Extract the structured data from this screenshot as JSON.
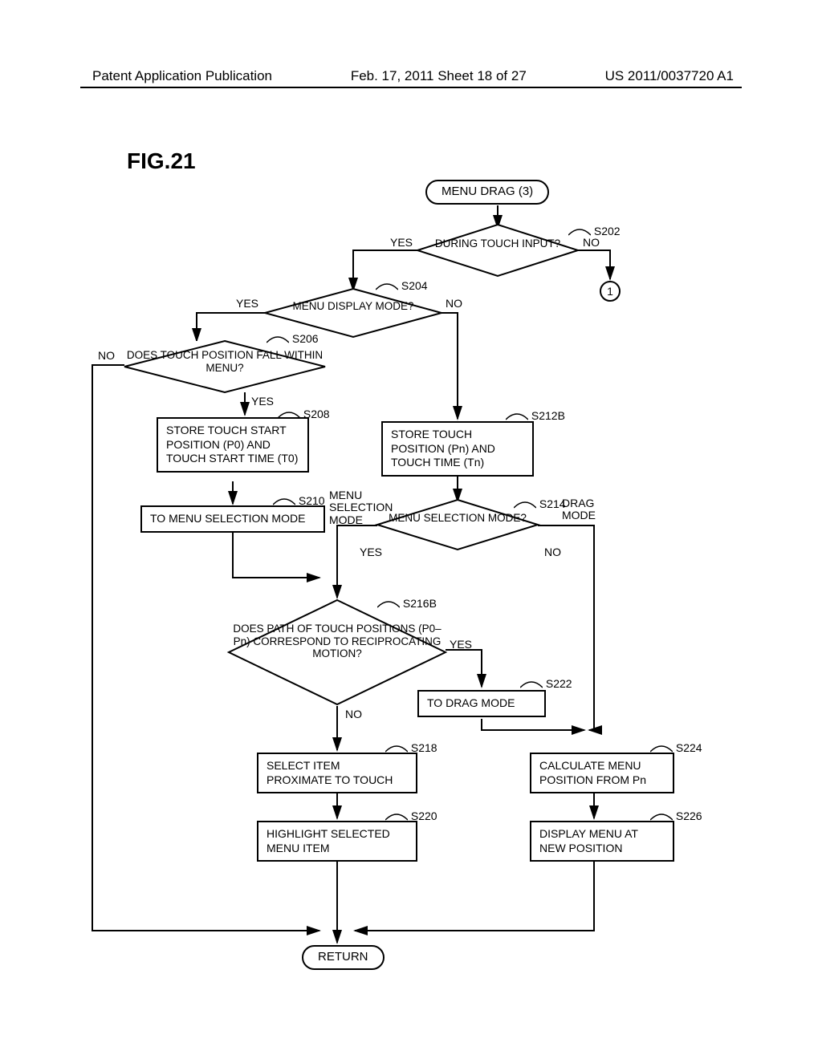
{
  "header": {
    "left": "Patent Application Publication",
    "center": "Feb. 17, 2011  Sheet 18 of 27",
    "right": "US 2011/0037720 A1"
  },
  "figure_label": "FIG.21",
  "chart_data": {
    "type": "flowchart",
    "title": "MENU DRAG (3)",
    "nodes": [
      {
        "id": "start",
        "type": "terminal",
        "text": "MENU DRAG (3)"
      },
      {
        "id": "s202",
        "type": "decision",
        "step": "S202",
        "text": "DURING TOUCH INPUT?",
        "yes_to": "s204",
        "no_to": "conn1"
      },
      {
        "id": "s204",
        "type": "decision",
        "step": "S204",
        "text": "MENU DISPLAY MODE?",
        "yes_to": "s206",
        "no_to": "s212b"
      },
      {
        "id": "s206",
        "type": "decision",
        "step": "S206",
        "text": "DOES TOUCH POSITION FALL WITHIN MENU?",
        "yes_to": "s208",
        "no_to": "return"
      },
      {
        "id": "s208",
        "type": "process",
        "step": "S208",
        "text": "STORE TOUCH START POSITION (P0) AND TOUCH START TIME (T0)",
        "to": "s210"
      },
      {
        "id": "s210",
        "type": "process",
        "step": "S210",
        "text": "TO MENU SELECTION MODE",
        "to": "s216b_path"
      },
      {
        "id": "s212b",
        "type": "process",
        "step": "S212B",
        "text": "STORE TOUCH POSITION (Pn) AND TOUCH TIME (Tn)",
        "to": "s214"
      },
      {
        "id": "s214",
        "type": "decision",
        "step": "S214",
        "text": "MENU SELECTION MODE?",
        "yes_label_side": "MENU SELECTION MODE",
        "no_label_side": "DRAG MODE",
        "yes_to": "s216b",
        "no_to": "s224"
      },
      {
        "id": "s216b",
        "type": "decision",
        "step": "S216B",
        "text": "DOES PATH OF TOUCH POSITIONS (P0–Pn) CORRESPOND TO RECIPROCATING MOTION?",
        "yes_to": "s222",
        "no_to": "s218"
      },
      {
        "id": "s218",
        "type": "process",
        "step": "S218",
        "text": "SELECT ITEM PROXIMATE TO TOUCH",
        "to": "s220"
      },
      {
        "id": "s220",
        "type": "process",
        "step": "S220",
        "text": "HIGHLIGHT SELECTED MENU ITEM",
        "to": "return"
      },
      {
        "id": "s222",
        "type": "process",
        "step": "S222",
        "text": "TO DRAG MODE",
        "to": "s224"
      },
      {
        "id": "s224",
        "type": "process",
        "step": "S224",
        "text": "CALCULATE MENU POSITION FROM Pn",
        "to": "s226"
      },
      {
        "id": "s226",
        "type": "process",
        "step": "S226",
        "text": "DISPLAY MENU AT NEW POSITION",
        "to": "return"
      },
      {
        "id": "conn1",
        "type": "connector",
        "text": "1"
      },
      {
        "id": "return",
        "type": "terminal",
        "text": "RETURN"
      }
    ],
    "labels": {
      "yes": "YES",
      "no": "NO"
    }
  }
}
